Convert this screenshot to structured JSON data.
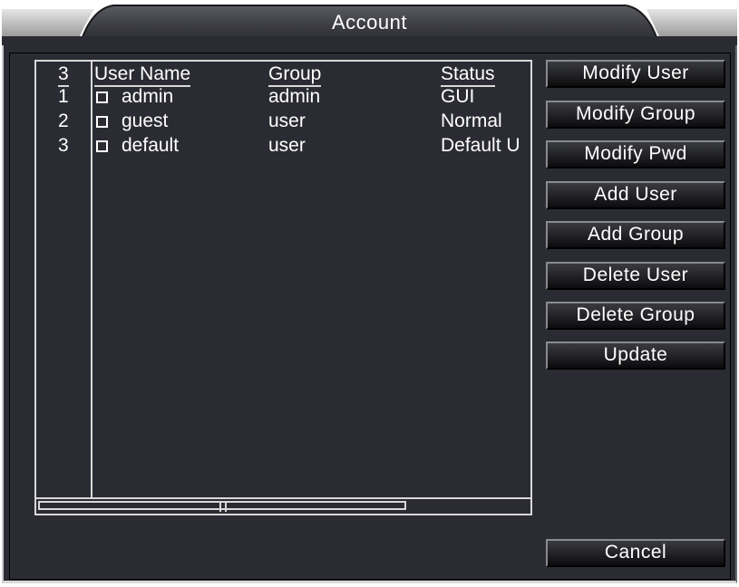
{
  "window": {
    "title": "Account"
  },
  "table": {
    "count_header": "3",
    "headers": {
      "user_name": "User Name",
      "group": "Group",
      "status": "Status"
    },
    "rows": [
      {
        "index": "1",
        "user_name": "admin",
        "group": "admin",
        "status": "GUI",
        "checked": false
      },
      {
        "index": "2",
        "user_name": "guest",
        "group": "user",
        "status": "Normal",
        "checked": false
      },
      {
        "index": "3",
        "user_name": "default",
        "group": "user",
        "status": "Default U",
        "checked": false
      }
    ]
  },
  "buttons": {
    "modify_user": "Modify User",
    "modify_group": "Modify Group",
    "modify_pwd": "Modify Pwd",
    "add_user": "Add User",
    "add_group": "Add Group",
    "delete_user": "Delete User",
    "delete_group": "Delete Group",
    "update": "Update",
    "cancel": "Cancel"
  },
  "colors": {
    "panel_background": "#2b2c33",
    "text": "#ffffff",
    "border": "#d8d8d8"
  }
}
